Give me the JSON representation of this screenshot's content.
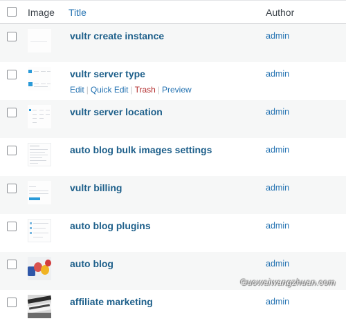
{
  "columns": {
    "image": "Image",
    "title": "Title",
    "author": "Author"
  },
  "rows": [
    {
      "title": "vultr create instance",
      "author": "admin",
      "thumb": "blank-screenshot"
    },
    {
      "title": "vultr server type",
      "author": "admin",
      "thumb": "blue-cards-screenshot",
      "actions": {
        "edit": "Edit",
        "quick_edit": "Quick Edit",
        "trash": "Trash",
        "preview": "Preview"
      }
    },
    {
      "title": "vultr server location",
      "author": "admin",
      "thumb": "location-grid-screenshot"
    },
    {
      "title": "auto blog bulk images settings",
      "author": "admin",
      "thumb": "settings-form-screenshot"
    },
    {
      "title": "vultr billing",
      "author": "admin",
      "thumb": "billing-screenshot"
    },
    {
      "title": "auto blog plugins",
      "author": "admin",
      "thumb": "plugins-list-screenshot"
    },
    {
      "title": "auto blog",
      "author": "admin",
      "thumb": "blog-3d-letters-image"
    },
    {
      "title": "affiliate marketing",
      "author": "admin",
      "thumb": "affiliate-marketing-image"
    }
  ],
  "watermark": "Guowaiwangzhuan.com",
  "colors": {
    "link": "#2271b1",
    "title_link": "#1d5f8a",
    "trash": "#b32d2e",
    "row_alt": "#f6f7f7"
  }
}
